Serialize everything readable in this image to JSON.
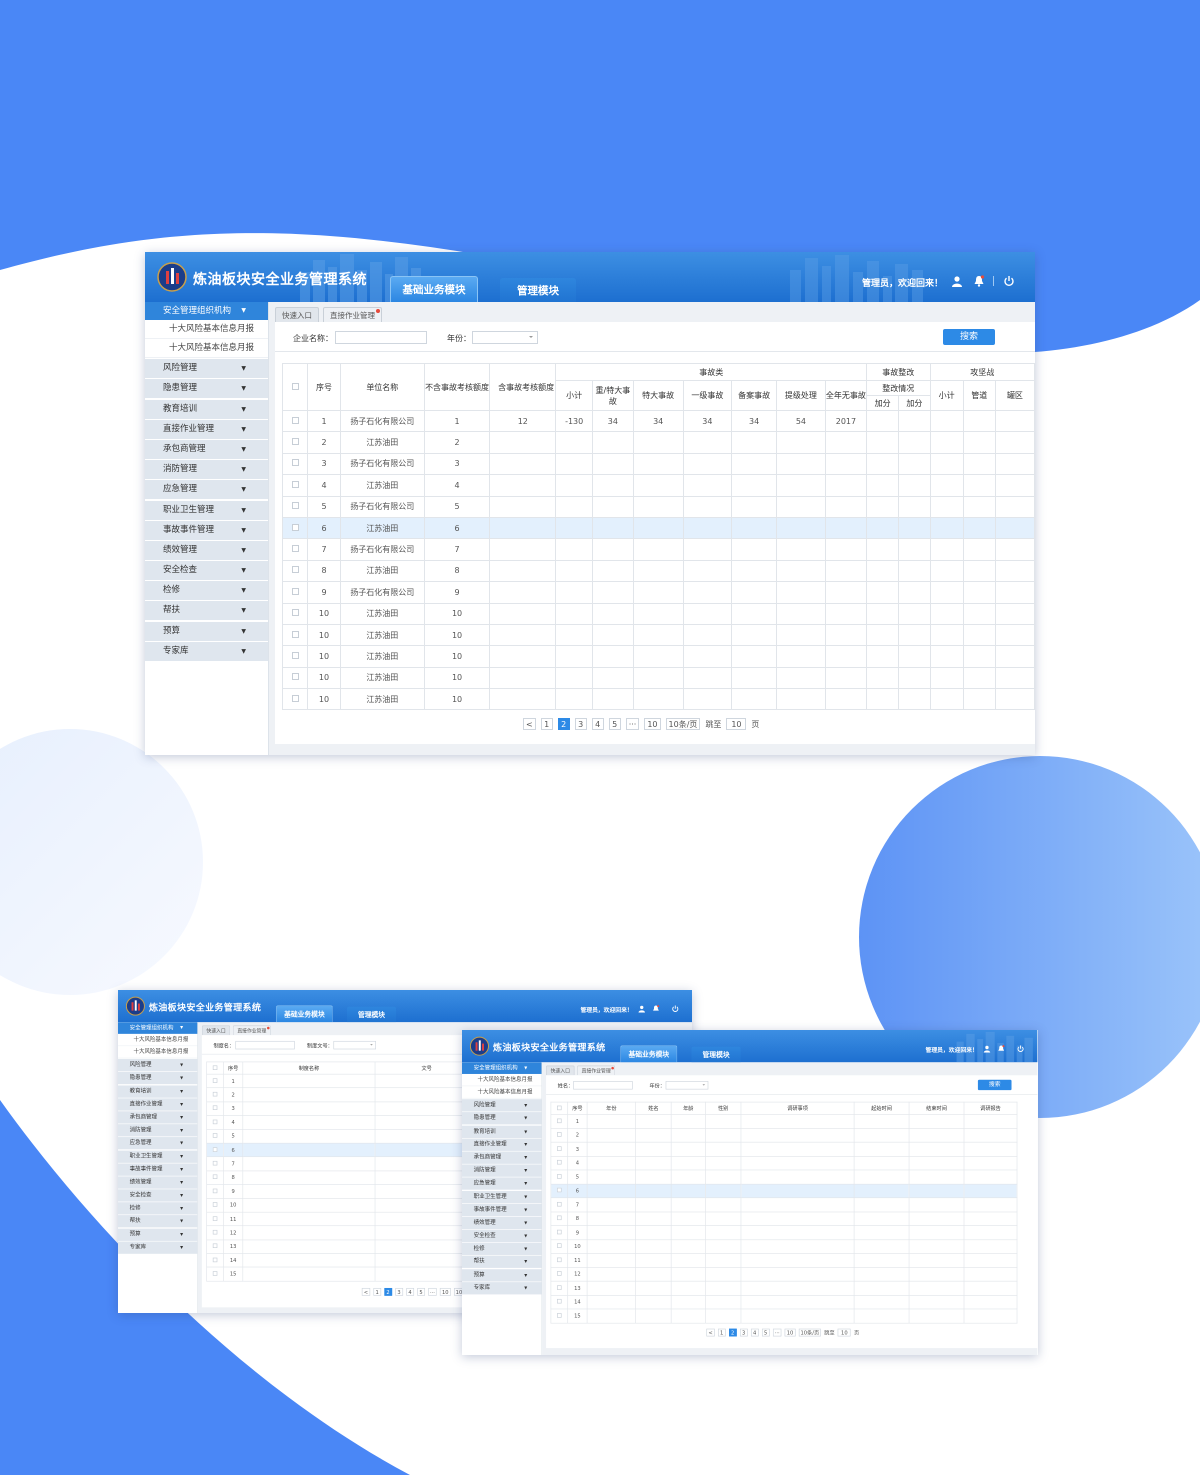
{
  "app": {
    "title": "炼油板块安全业务管理系统",
    "tabs": [
      {
        "label": "基础业务模块",
        "active": true
      },
      {
        "label": "管理模块",
        "active": false
      }
    ],
    "user_greeting": "管理员，欢迎回来！"
  },
  "sidebar": {
    "head": "安全管理组织机构",
    "subitems": [
      "十大风险基本信息月报",
      "十大风险基本信息月报"
    ],
    "items": [
      "风险管理",
      "隐患管理",
      "教育培训",
      "直接作业管理",
      "承包商管理",
      "消防管理",
      "应急管理",
      "职业卫生管理",
      "事故事件管理",
      "绩效管理",
      "安全检查",
      "检修",
      "帮扶",
      "预算",
      "专家库"
    ]
  },
  "breadcrumbs": [
    "快速入口",
    "直接作业管理"
  ],
  "main_screen": {
    "filter": {
      "company_label": "企业名称：",
      "year_label": "年份：",
      "search_label": "搜索"
    },
    "table": {
      "headers": {
        "seq": "序号",
        "unit": "单位名称",
        "excl": "不含事故考核额度",
        "incl": "含事故考核额度",
        "accident_group": "事故类",
        "accident_cols": [
          "小计",
          "重/特大事故",
          "特大事故",
          "一级事故",
          "备案事故",
          "提级处理",
          "全年无事故"
        ],
        "rectify_group": "事故整改",
        "rectify_sub": "整改情况",
        "rectify_cols": [
          "加分",
          "加分"
        ],
        "battle_group": "攻坚战",
        "battle_cols": [
          "小计",
          "管道",
          "罐区"
        ]
      },
      "rows": [
        {
          "seq": "1",
          "unit": "扬子石化有限公司",
          "excl": "1",
          "incl": "12",
          "vals": [
            "-130",
            "34",
            "34",
            "34",
            "34",
            "54",
            "2017"
          ]
        },
        {
          "seq": "2",
          "unit": "江苏油田",
          "excl": "2"
        },
        {
          "seq": "3",
          "unit": "扬子石化有限公司",
          "excl": "3"
        },
        {
          "seq": "4",
          "unit": "江苏油田",
          "excl": "4"
        },
        {
          "seq": "5",
          "unit": "扬子石化有限公司",
          "excl": "5"
        },
        {
          "seq": "6",
          "unit": "江苏油田",
          "excl": "6"
        },
        {
          "seq": "7",
          "unit": "扬子石化有限公司",
          "excl": "7"
        },
        {
          "seq": "8",
          "unit": "江苏油田",
          "excl": "8"
        },
        {
          "seq": "9",
          "unit": "扬子石化有限公司",
          "excl": "9"
        },
        {
          "seq": "10",
          "unit": "江苏油田",
          "excl": "10"
        },
        {
          "seq": "10",
          "unit": "江苏油田",
          "excl": "10"
        },
        {
          "seq": "10",
          "unit": "江苏油田",
          "excl": "10"
        },
        {
          "seq": "10",
          "unit": "江苏油田",
          "excl": "10"
        },
        {
          "seq": "10",
          "unit": "江苏油田",
          "excl": "10"
        }
      ],
      "highlight_row": 5
    }
  },
  "screen_a": {
    "filter": {
      "label1": "制度名：",
      "label2": "制度文号："
    },
    "headers": [
      "序号",
      "制度名称",
      "文号"
    ],
    "highlight_row": 5
  },
  "screen_b": {
    "filter": {
      "label1": "姓名：",
      "label2": "年份：",
      "search_label": "搜索"
    },
    "headers": [
      "序号",
      "年份",
      "姓名",
      "年龄",
      "性别",
      "调研事项",
      "起始时间",
      "结束时间",
      "调研报告"
    ],
    "highlight_row": 5
  },
  "row_numbers_15": [
    "1",
    "2",
    "3",
    "4",
    "5",
    "6",
    "7",
    "8",
    "9",
    "10",
    "11",
    "12",
    "13",
    "14",
    "15"
  ],
  "pagination": {
    "prev": "<",
    "pages": [
      "1",
      "2",
      "3",
      "4",
      "5"
    ],
    "current": "2",
    "ellipsis": "···",
    "last": "10",
    "per_page": "10条/页",
    "jump_label": "跳至",
    "jump_value": "10",
    "page_unit": "页"
  },
  "colors": {
    "brand_blue": "#2f85db",
    "background_blue": "#4a87f6",
    "header_gradient_top": "#3d8fe3",
    "highlight_row": "#e3f0fd"
  }
}
